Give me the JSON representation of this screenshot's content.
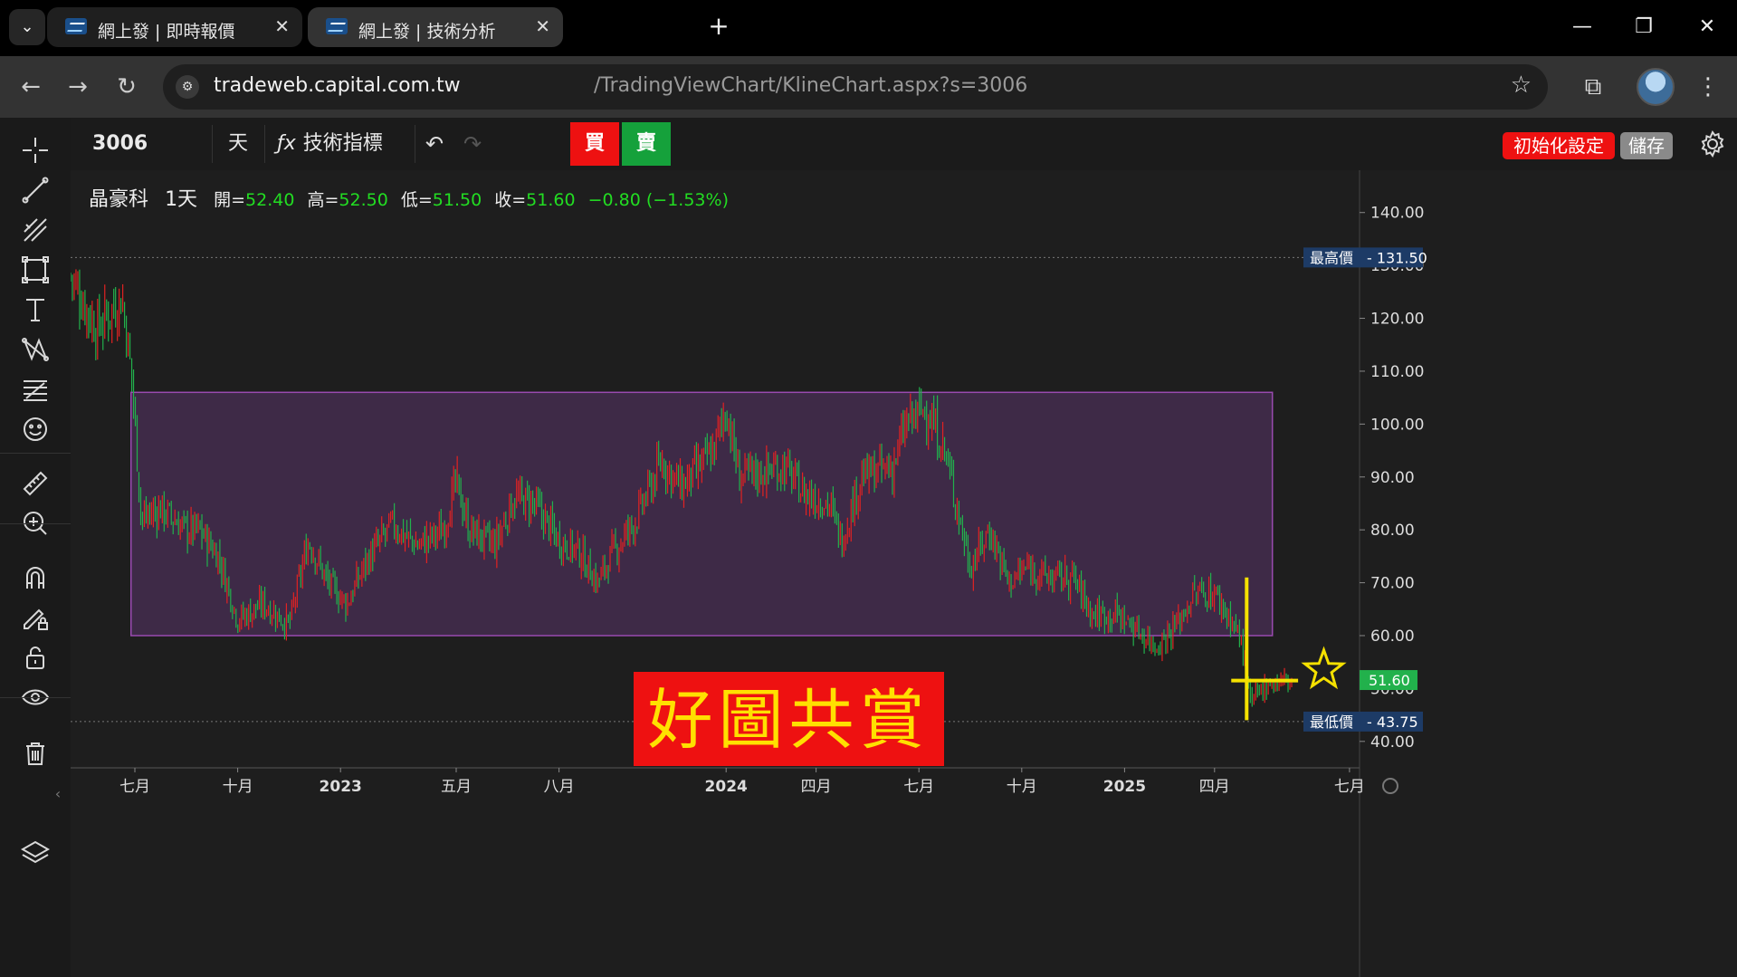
{
  "browser": {
    "tabs": [
      {
        "title": "網上發 | 即時報價",
        "active": false
      },
      {
        "title": "網上發 | 技術分析",
        "active": true
      }
    ],
    "url_host": "tradeweb.capital.com.tw",
    "url_path": "/TradingViewChart/KlineChart.aspx?s=3006"
  },
  "header": {
    "symbol": "3006",
    "interval_label": "天",
    "indicators_label": "技術指標",
    "buy_label": "買",
    "sell_label": "賣",
    "reset_label": "初始化設定",
    "save_label": "儲存"
  },
  "legend": {
    "name": "晶豪科",
    "interval": "1天",
    "open_key": "開=",
    "open_val": "52.40",
    "high_key": "高=",
    "high_val": "52.50",
    "low_key": "低=",
    "low_val": "51.50",
    "close_key": "收=",
    "close_val": "51.60",
    "change": "−0.80 (−1.53%)"
  },
  "annotations": {
    "banner_text": "好圖共賞",
    "max_label": "最高價",
    "min_label": "最低價",
    "max_value": "131.50",
    "min_value": "43.75",
    "last_value": "51.60"
  },
  "colors": {
    "up": "#e22222",
    "down": "#22b14c",
    "box_fill": "#3e2a47",
    "box_stroke": "#9a4ab0",
    "banner_bg": "#ee1111",
    "banner_text": "#ffe000",
    "marker": "#f5e100"
  },
  "chart_data": {
    "type": "candlestick",
    "ylim": [
      35,
      148
    ],
    "yticks": [
      "140.00",
      "130.00",
      "120.00",
      "110.00",
      "100.00",
      "90.00",
      "80.00",
      "70.00",
      "60.00",
      "50.00",
      "40.00"
    ],
    "xticks": [
      "七月",
      "十月",
      "2023",
      "五月",
      "八月",
      "2024",
      "四月",
      "七月",
      "十月",
      "2025",
      "四月",
      "七月"
    ],
    "xtick_positions": [
      0.05,
      0.13,
      0.21,
      0.3,
      0.38,
      0.51,
      0.58,
      0.66,
      0.74,
      0.82,
      0.89,
      0.995
    ],
    "anchors": [
      [
        0.0,
        128
      ],
      [
        0.02,
        118
      ],
      [
        0.04,
        124
      ],
      [
        0.048,
        108
      ],
      [
        0.055,
        82
      ],
      [
        0.07,
        84
      ],
      [
        0.09,
        80
      ],
      [
        0.1,
        80
      ],
      [
        0.115,
        75
      ],
      [
        0.13,
        63
      ],
      [
        0.15,
        66
      ],
      [
        0.17,
        62
      ],
      [
        0.185,
        78
      ],
      [
        0.2,
        70
      ],
      [
        0.215,
        66
      ],
      [
        0.23,
        74
      ],
      [
        0.25,
        81
      ],
      [
        0.27,
        77
      ],
      [
        0.29,
        80
      ],
      [
        0.3,
        89
      ],
      [
        0.31,
        80
      ],
      [
        0.33,
        77
      ],
      [
        0.345,
        86
      ],
      [
        0.36,
        85
      ],
      [
        0.38,
        78
      ],
      [
        0.395,
        76
      ],
      [
        0.41,
        70
      ],
      [
        0.42,
        75
      ],
      [
        0.44,
        82
      ],
      [
        0.46,
        93
      ],
      [
        0.475,
        88
      ],
      [
        0.49,
        92
      ],
      [
        0.5,
        95
      ],
      [
        0.51,
        103
      ],
      [
        0.52,
        90
      ],
      [
        0.54,
        91
      ],
      [
        0.555,
        92
      ],
      [
        0.57,
        87
      ],
      [
        0.59,
        85
      ],
      [
        0.6,
        78
      ],
      [
        0.615,
        90
      ],
      [
        0.64,
        92
      ],
      [
        0.65,
        100
      ],
      [
        0.665,
        103
      ],
      [
        0.68,
        95
      ],
      [
        0.69,
        84
      ],
      [
        0.7,
        73
      ],
      [
        0.715,
        80
      ],
      [
        0.73,
        70
      ],
      [
        0.745,
        73
      ],
      [
        0.76,
        71
      ],
      [
        0.78,
        71
      ],
      [
        0.795,
        64
      ],
      [
        0.815,
        64
      ],
      [
        0.83,
        61
      ],
      [
        0.845,
        58
      ],
      [
        0.86,
        62
      ],
      [
        0.875,
        68
      ],
      [
        0.89,
        68
      ],
      [
        0.905,
        62
      ],
      [
        0.912,
        58
      ],
      [
        0.918,
        47
      ],
      [
        0.93,
        51
      ],
      [
        0.95,
        51.6
      ]
    ],
    "rectangle": {
      "price_top": 106,
      "price_bottom": 60,
      "x_start": 0.047,
      "x_end": 0.935
    },
    "max_price": 131.5,
    "min_price": 43.75,
    "last_price": 51.6
  }
}
